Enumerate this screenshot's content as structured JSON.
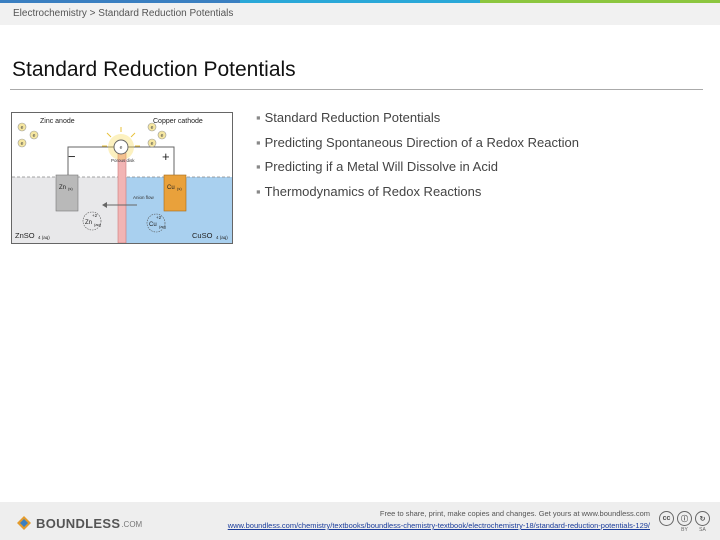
{
  "header": {
    "accent_colors": [
      "#3a7fc1",
      "#2aa8d8",
      "#8cc63f"
    ],
    "breadcrumb": "Electrochemistry > Standard Reduction Potentials"
  },
  "slide": {
    "title": "Standard Reduction Potentials",
    "bullets": [
      "Standard Reduction Potentials",
      "Predicting Spontaneous Direction of a Redox Reaction",
      "Predicting if a Metal Will Dissolve in Acid",
      "Thermodynamics of Redox Reactions"
    ]
  },
  "figure": {
    "labels": {
      "zinc_anode": "Zinc anode",
      "copper_cathode": "Copper cathode",
      "porous_disk": "Porous disk",
      "anion_flow": "Anion flow",
      "minus": "−",
      "plus": "+",
      "electron": "e",
      "zn_solid": "Zn",
      "zn_sub": "(s)",
      "cu_solid": "Cu",
      "cu_sub": "(s)",
      "zn_ion": "Zn",
      "zn_ion_charge": "+2",
      "zn_ion_sub": "(aq)",
      "cu_ion": "Cu",
      "cu_ion_charge": "+2",
      "cu_ion_sub": "(aq)",
      "znso4": "ZnSO",
      "znso4_sub": "4 (aq)",
      "cuso4": "CuSO",
      "cuso4_sub": "4 (aq)"
    },
    "colors": {
      "zinc_solution": "#e8e8ea",
      "copper_solution": "#a9d0ef",
      "zinc_electrode": "#b9b9b9",
      "copper_electrode": "#e9a13b",
      "porous_disk": "#f2b4b4",
      "bulb_glow": "#f7d64a"
    }
  },
  "footer": {
    "logo_text": "BOUNDLESS",
    "logo_suffix": ".COM",
    "note": "Free to share, print, make copies and changes. Get yours at www.boundless.com",
    "link": "www.boundless.com/chemistry/textbooks/boundless-chemistry-textbook/electrochemistry-18/standard-reduction-potentials-129/",
    "cc": [
      "cc",
      "BY",
      "SA"
    ]
  }
}
